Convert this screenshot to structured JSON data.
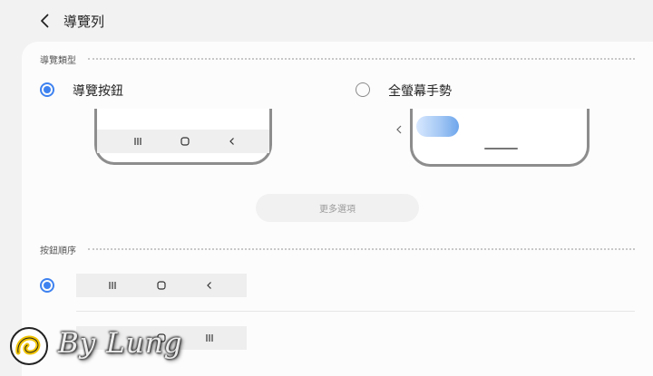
{
  "header": {
    "title": "導覽列"
  },
  "nav_type": {
    "section_label": "導覽類型",
    "options": [
      {
        "label": "導覽按鈕",
        "selected": true
      },
      {
        "label": "全螢幕手勢",
        "selected": false
      }
    ],
    "more_button_label": "更多選項"
  },
  "button_order": {
    "section_label": "按鈕順序",
    "orders": [
      {
        "selected": true,
        "icons": [
          "recents-icon",
          "home-icon",
          "back-icon"
        ]
      },
      {
        "selected": false,
        "icons": [
          "back-icon",
          "home-icon",
          "recents-icon"
        ]
      }
    ]
  },
  "watermark": {
    "text": "By Lung"
  },
  "colors": {
    "accent": "#3e82f0",
    "background": "#f2f2f2",
    "card": "#fcfcfc"
  }
}
